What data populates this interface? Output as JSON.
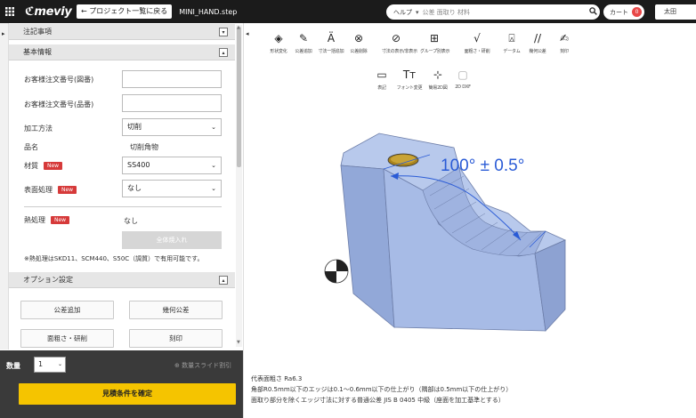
{
  "topbar": {
    "logo": "meviy",
    "back_label": "← プロジェクト一覧に戻る",
    "filename": "MINI_HAND.step",
    "help_label": "ヘルプ",
    "help_caret": "▾",
    "search_placeholder": "公差  面取り  材料",
    "cart_label": "カート",
    "cart_count": "0",
    "user_label": "太田"
  },
  "left_panel": {
    "notes_header": "注記事項",
    "basic_header": "基本情報",
    "labels": {
      "customer_order": "お客様注文番号(図番)",
      "customer_order2": "お客様注文番号(品番)",
      "process": "加工方法",
      "product_name": "品名",
      "material": "材質",
      "surface": "表面処理",
      "heat": "熱処理"
    },
    "new_badge": "New",
    "values": {
      "process": "切削",
      "product_name": "切削角物",
      "material": "SS400",
      "surface": "なし",
      "heat": "なし"
    },
    "bulk_btn": "全体焼入れ",
    "heat_note": "※熱処理はSKD11、SCM440、S50C（調質）で有用可能です。",
    "option_header": "オプション設定",
    "options": [
      "公差追加",
      "幾何公差",
      "面粗さ・研削",
      "刻印"
    ],
    "collapse_glyph": "▸",
    "toggle_closed": "▾",
    "toggle_open": "▴"
  },
  "bottom_bar": {
    "qty_label": "数量",
    "qty_value": "1",
    "slide_link": "⊕ 数量スライド割引",
    "confirm_label": "見積条件を確定"
  },
  "toolbar": {
    "tools_row1": [
      {
        "icon": "◈",
        "label": "形状変化"
      },
      {
        "icon": "✎",
        "label": "公差追加"
      },
      {
        "icon": "Ä",
        "label": "寸法一括追加"
      },
      {
        "icon": "⊗",
        "label": "公差削除"
      },
      {
        "icon": "⊘",
        "label": "寸法の表示/非表示"
      },
      {
        "icon": "⊞",
        "label": "グループ別表示"
      },
      {
        "icon": "√",
        "label": "面粗さ・研削"
      },
      {
        "icon": "⍓",
        "label": "データム"
      },
      {
        "icon": "//",
        "label": "幾何公差"
      },
      {
        "icon": "✍",
        "label": "刻印"
      }
    ],
    "tools_row2": [
      {
        "icon": "▭",
        "label": "表記"
      },
      {
        "icon": "Tт",
        "label": "フォント変更"
      },
      {
        "icon": "⊹",
        "label": "簡易2D図"
      },
      {
        "icon": "▢",
        "label": "2D DXF"
      }
    ]
  },
  "viewer": {
    "dimension_text": "100° ± 0.5°",
    "footnote_lines": [
      "代表面粗さ Ra6.3",
      "角部R0.5mm以下のエッジは0.1～0.6mm以下の仕上がり（隅部は0.5mm以下の仕上がり）",
      "面取り部分を除くエッジ寸法に対する普通公差 JIS B 0405 中級（座面を加工基準とする）"
    ]
  },
  "colors": {
    "topbar": "#1b1b1b",
    "accent_yellow": "#f5c400",
    "new_badge": "#d63a3a",
    "part_fill": "#a7bbe6",
    "dimension_blue": "#2a5bd6",
    "hole_gold": "#a8831e"
  }
}
